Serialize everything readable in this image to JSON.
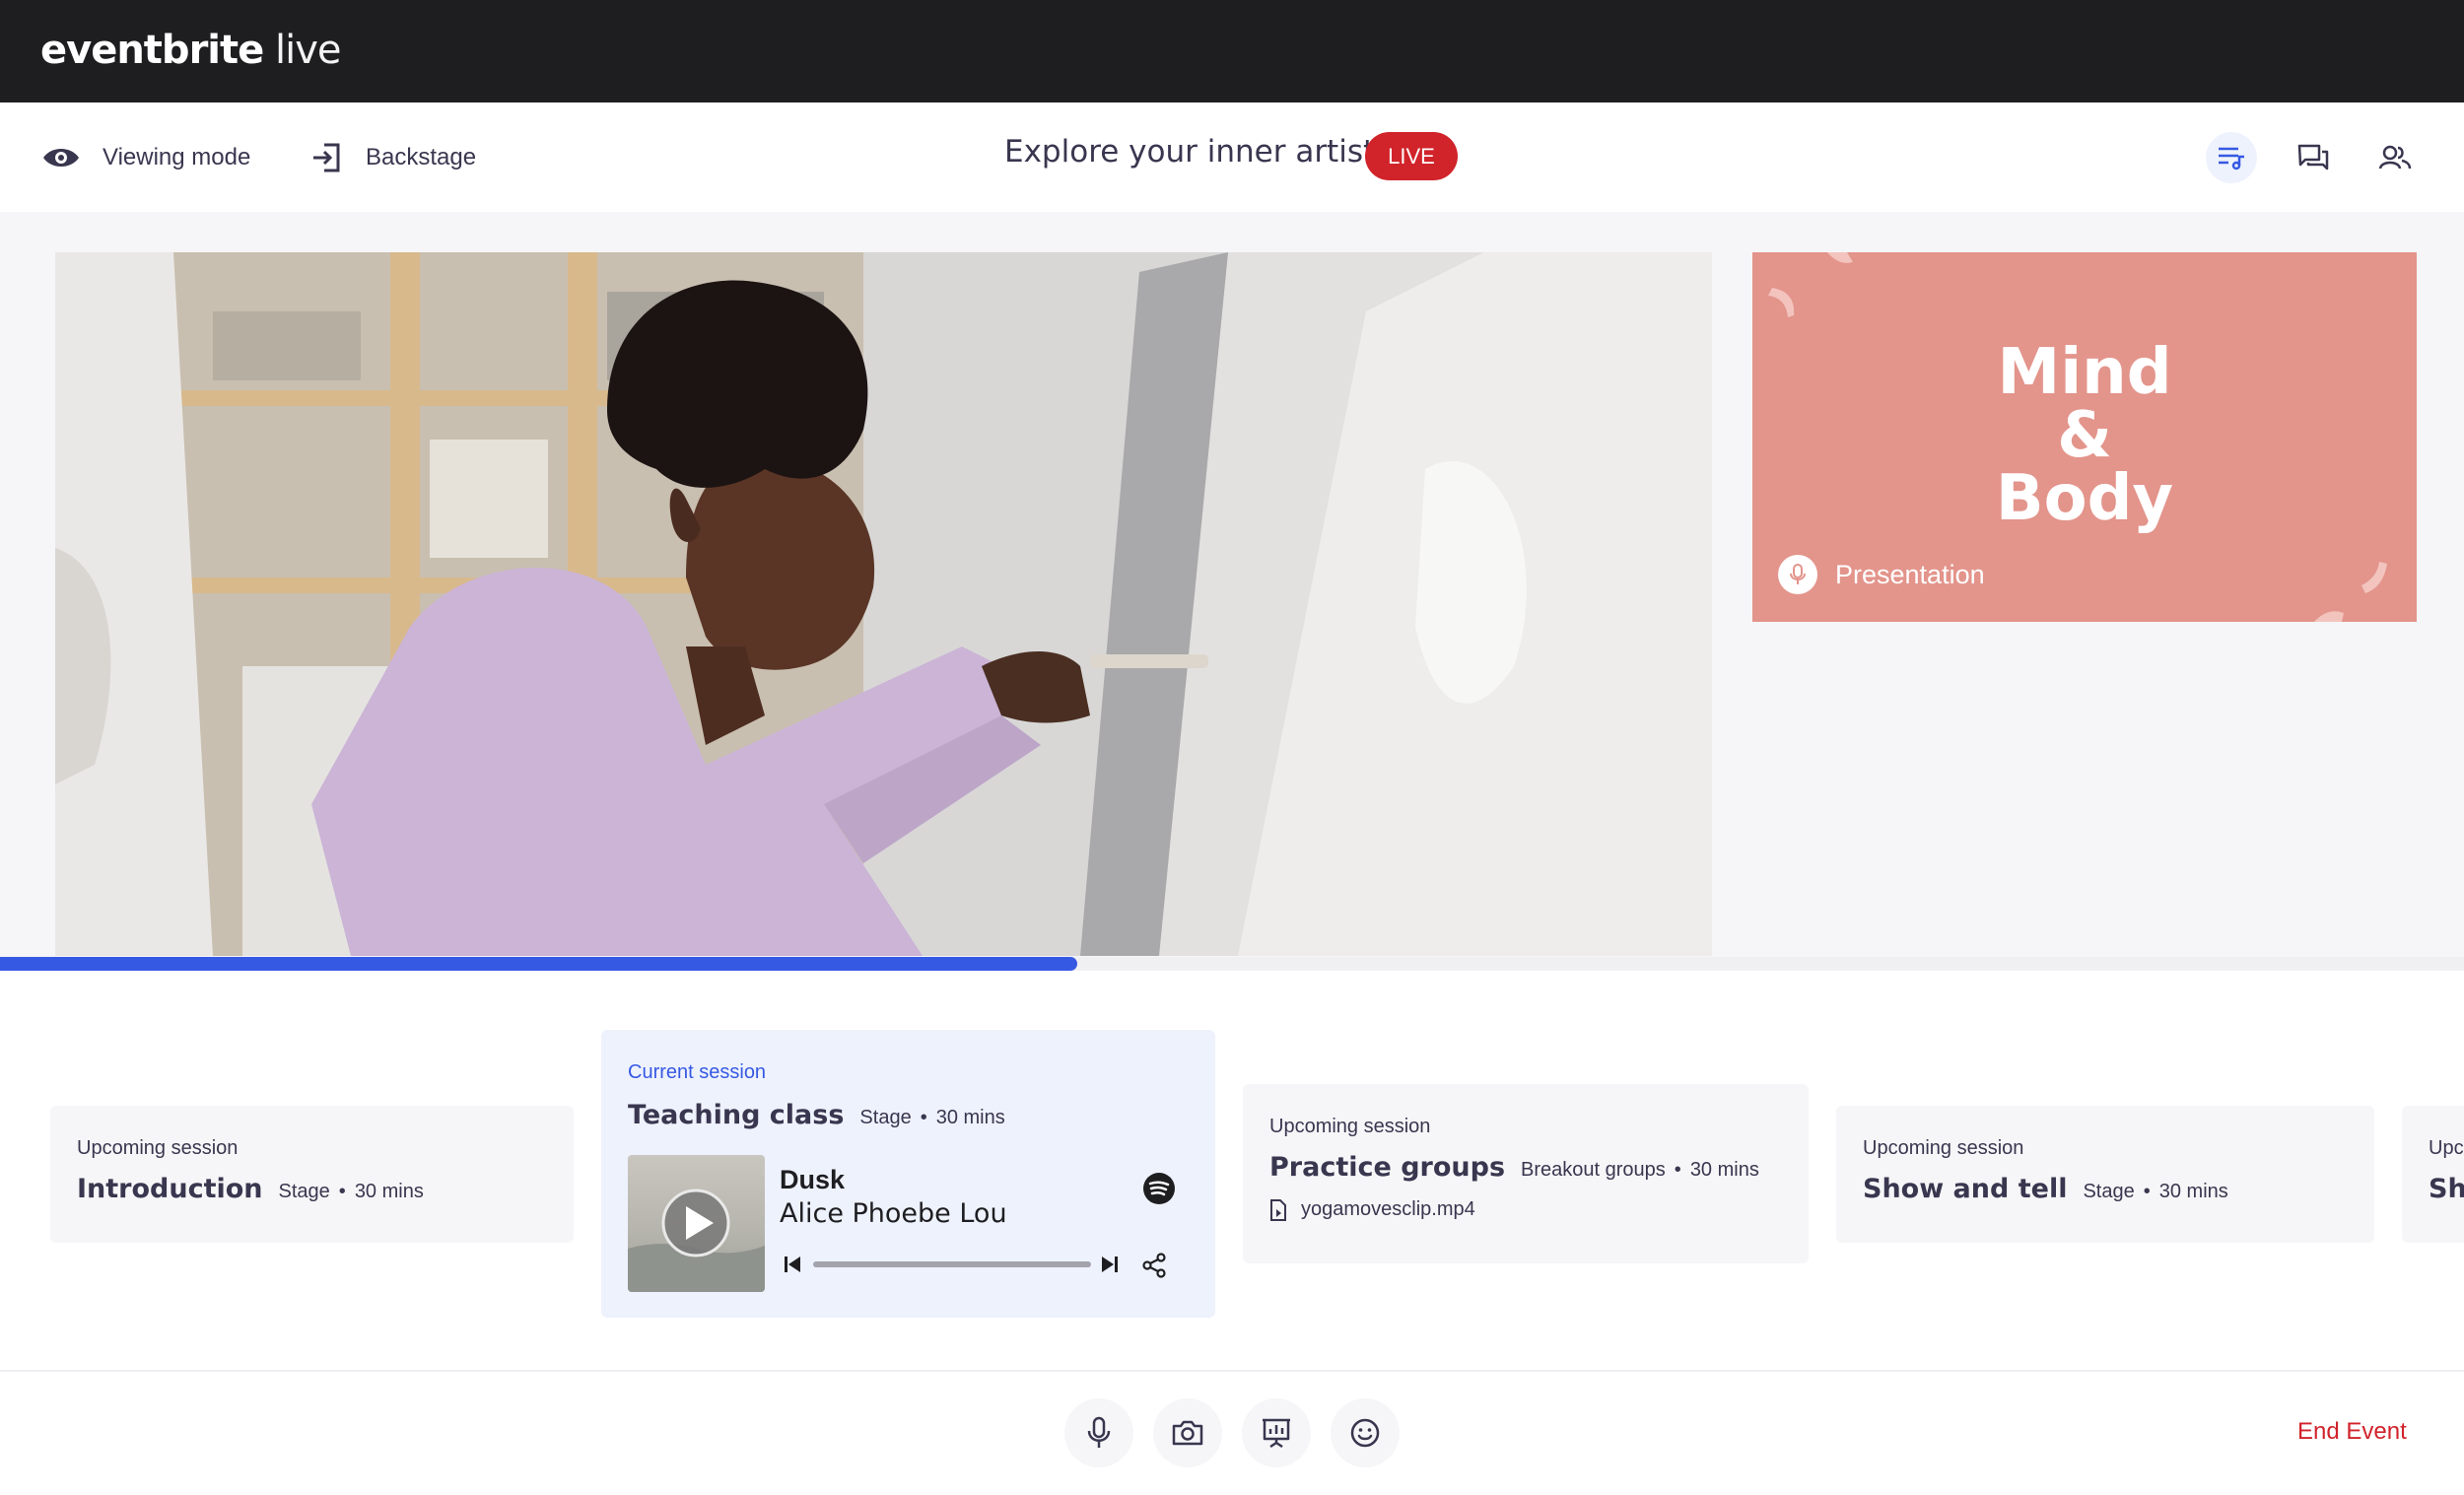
{
  "brand": {
    "logo_bold": "eventbrite",
    "logo_light": "live"
  },
  "nav": {
    "viewing_mode": "Viewing mode",
    "backstage": "Backstage",
    "event_title": "Explore your inner artist",
    "live_badge": "LIVE",
    "right_icons": [
      "playlist-icon",
      "chat-icon",
      "attendees-icon"
    ]
  },
  "stage": {
    "slide": {
      "line1": "Mind",
      "line2": "&",
      "line3": "Body",
      "caption": "Presentation",
      "bg": "#e3948b"
    }
  },
  "progress": {
    "fraction": 0.437,
    "color": "#3659e3"
  },
  "sessions": [
    {
      "label": "Upcoming session",
      "name": "Introduction",
      "location": "Stage",
      "duration": "30 mins"
    },
    {
      "label": "Current session",
      "name": "Teaching class",
      "location": "Stage",
      "duration": "30 mins",
      "player": {
        "song": "Dusk",
        "artist": "Alice Phoebe Lou"
      }
    },
    {
      "label": "Upcoming session",
      "name": "Practice groups",
      "location": "Breakout groups",
      "duration": "30 mins",
      "file": "yogamovesclip.mp4"
    },
    {
      "label": "Upcoming session",
      "name": "Show and tell",
      "location": "Stage",
      "duration": "30 mins"
    },
    {
      "label": "Upco",
      "name": "Sho"
    }
  ],
  "separator": "•",
  "controls": {
    "icons": [
      "microphone-icon",
      "camera-icon",
      "present-icon",
      "emoji-icon"
    ],
    "end_event": "End Event"
  },
  "colors": {
    "accent": "#3659e3",
    "live": "#d1232a",
    "topbar": "#1e1e21"
  }
}
